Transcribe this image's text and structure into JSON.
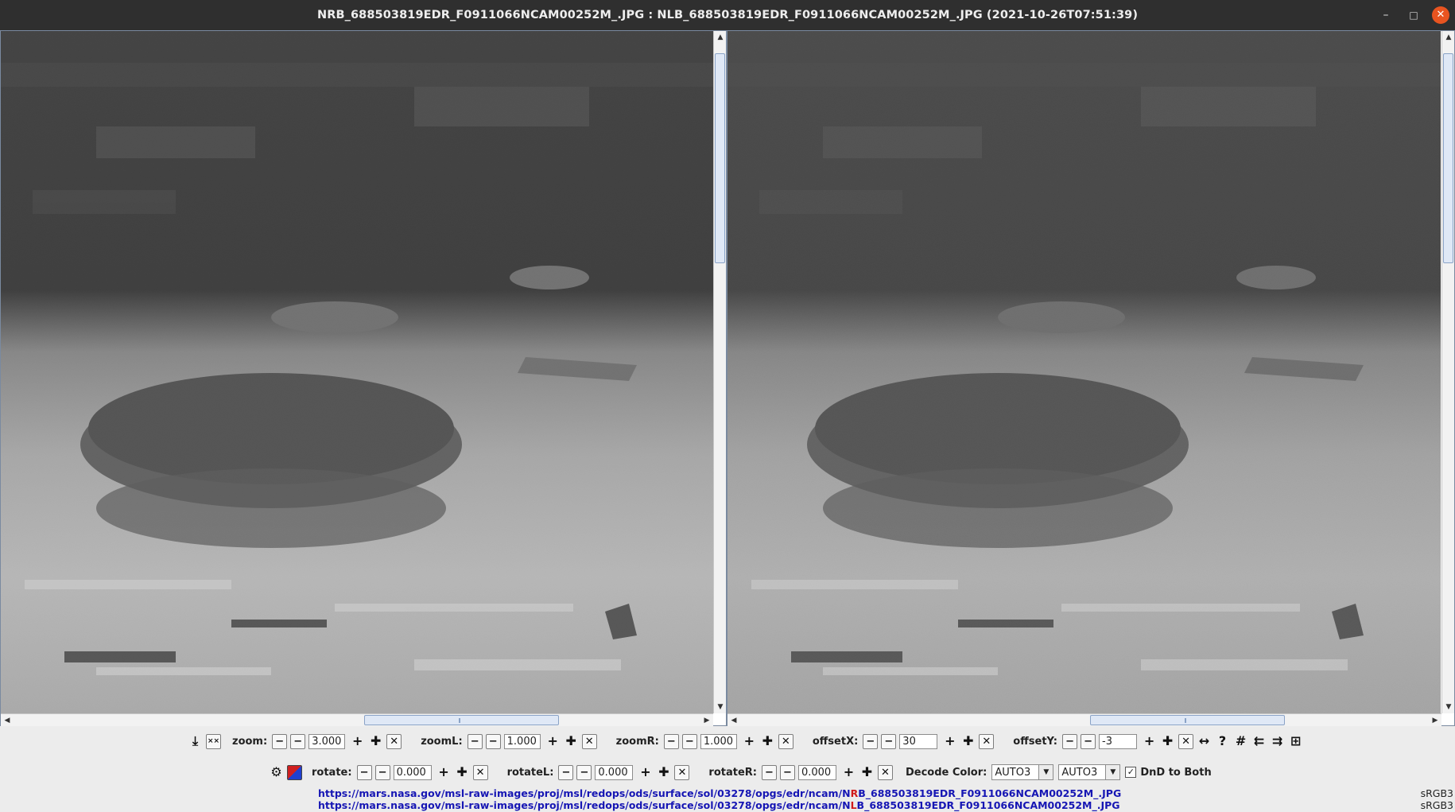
{
  "window": {
    "title": "NRB_688503819EDR_F0911066NCAM00252M_.JPG : NLB_688503819EDR_F0911066NCAM00252M_.JPG (2021-10-26T07:51:39)",
    "buttons": {
      "minimize": "–",
      "maximize": "□",
      "close": "✕"
    }
  },
  "toolbar1": {
    "zoom": {
      "label": "zoom:",
      "value": "3.000"
    },
    "zoomL": {
      "label": "zoomL:",
      "value": "1.000"
    },
    "zoomR": {
      "label": "zoomR:",
      "value": "1.000"
    },
    "offsetX": {
      "label": "offsetX:",
      "value": "30"
    },
    "offsetY": {
      "label": "offsetY:",
      "value": "-3"
    }
  },
  "toolbar2": {
    "rotate": {
      "label": "rotate:",
      "value": "0.000"
    },
    "rotateL": {
      "label": "rotateL:",
      "value": "0.000"
    },
    "rotateR": {
      "label": "rotateR:",
      "value": "0.000"
    },
    "decode_color": {
      "label": "Decode Color:",
      "left": "AUTO3",
      "right": "AUTO3"
    },
    "dnd": {
      "label": "DnD to Both",
      "checked": true
    }
  },
  "footer": {
    "url_right": {
      "prefix": "https://mars.nasa.gov/msl-raw-images/proj/msl/redops/ods/surface/sol/03278/opgs/edr/ncam/N",
      "highlight": "R",
      "suffix": "B_688503819EDR_F0911066NCAM00252M_.JPG"
    },
    "url_left": {
      "prefix": "https://mars.nasa.gov/msl-raw-images/proj/msl/redops/ods/surface/sol/03278/opgs/edr/ncam/N",
      "highlight": "L",
      "suffix": "B_688503819EDR_F0911066NCAM00252M_.JPG"
    },
    "color_space_1": "sRGB3",
    "color_space_2": "sRGB3"
  }
}
